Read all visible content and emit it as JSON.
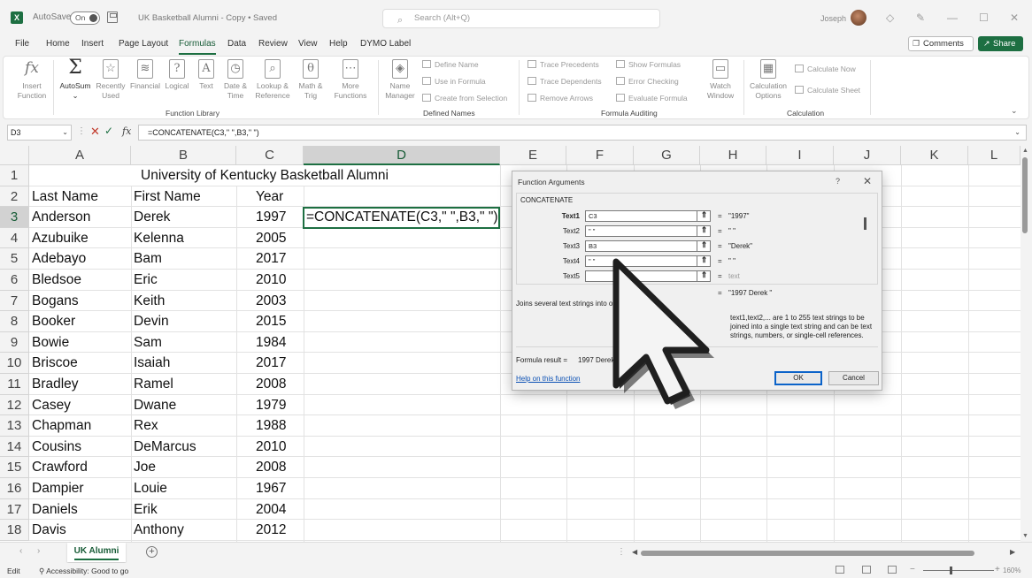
{
  "titlebar": {
    "autosave_label": "AutoSave",
    "autosave_state": "On",
    "doc_title": "UK Basketball Alumni - Copy • Saved",
    "search_placeholder": "Search (Alt+Q)",
    "user_name": "Joseph"
  },
  "menu": {
    "items": [
      "File",
      "Home",
      "Insert",
      "Page Layout",
      "Formulas",
      "Data",
      "Review",
      "View",
      "Help",
      "DYMO Label"
    ],
    "active": "Formulas",
    "comments_label": "Comments",
    "share_label": "Share"
  },
  "ribbon": {
    "insert_function": "Insert\nFunction",
    "autosum": "AutoSum",
    "recently_used": "Recently\nUsed",
    "financial": "Financial",
    "logical": "Logical",
    "text": "Text",
    "date_time": "Date &\nTime",
    "lookup_reference": "Lookup &\nReference",
    "math_trig": "Math &\nTrig",
    "more_functions": "More\nFunctions",
    "function_library": "Function Library",
    "name_manager": "Name\nManager",
    "define_name": "Define Name",
    "use_in_formula": "Use in Formula",
    "create_from_selection": "Create from Selection",
    "defined_names": "Defined Names",
    "trace_precedents": "Trace Precedents",
    "trace_dependents": "Trace Dependents",
    "remove_arrows": "Remove Arrows",
    "show_formulas": "Show Formulas",
    "error_checking": "Error Checking",
    "evaluate_formula": "Evaluate Formula",
    "watch_window": "Watch\nWindow",
    "formula_auditing": "Formula Auditing",
    "calculation_options": "Calculation\nOptions",
    "calculate_now": "Calculate Now",
    "calculate_sheet": "Calculate Sheet",
    "calculation": "Calculation"
  },
  "formula_bar": {
    "name_box": "D3",
    "formula": "=CONCATENATE(C3,\" \",B3,\" \")"
  },
  "sheet": {
    "columns": [
      "A",
      "B",
      "C",
      "D",
      "E",
      "F",
      "G",
      "H",
      "I",
      "J",
      "K",
      "L"
    ],
    "title": "University of Kentucky Basketball Alumni",
    "headers": {
      "last": "Last Name",
      "first": "First Name",
      "year": "Year"
    },
    "rows": [
      {
        "num": "1"
      },
      {
        "num": "2"
      },
      {
        "num": "3",
        "last": "Anderson",
        "first": "Derek",
        "year": "1997"
      },
      {
        "num": "4",
        "last": "Azubuike",
        "first": "Kelenna",
        "year": "2005"
      },
      {
        "num": "5",
        "last": "Adebayo",
        "first": "Bam",
        "year": "2017"
      },
      {
        "num": "6",
        "last": "Bledsoe",
        "first": "Eric",
        "year": "2010"
      },
      {
        "num": "7",
        "last": "Bogans",
        "first": "Keith",
        "year": "2003"
      },
      {
        "num": "8",
        "last": "Booker",
        "first": "Devin",
        "year": "2015"
      },
      {
        "num": "9",
        "last": "Bowie",
        "first": "Sam",
        "year": "1984"
      },
      {
        "num": "10",
        "last": "Briscoe",
        "first": "Isaiah",
        "year": "2017"
      },
      {
        "num": "11",
        "last": "Bradley",
        "first": "Ramel",
        "year": "2008"
      },
      {
        "num": "12",
        "last": "Casey",
        "first": "Dwane",
        "year": "1979"
      },
      {
        "num": "13",
        "last": "Chapman",
        "first": "Rex",
        "year": "1988"
      },
      {
        "num": "14",
        "last": "Cousins",
        "first": "DeMarcus",
        "year": "2010"
      },
      {
        "num": "15",
        "last": "Crawford",
        "first": "Joe",
        "year": "2008"
      },
      {
        "num": "16",
        "last": "Dampier",
        "first": "Louie",
        "year": "1967"
      },
      {
        "num": "17",
        "last": "Daniels",
        "first": "Erik",
        "year": "2004"
      },
      {
        "num": "18",
        "last": "Davis",
        "first": "Anthony",
        "year": "2012"
      }
    ],
    "d3_text": "=CONCATENATE(C3,\" \",B3,\" \")",
    "tab_name": "UK Alumni"
  },
  "dialog": {
    "title": "Function Arguments",
    "help_glyph": "?",
    "close_glyph": "✕",
    "function_name": "CONCATENATE",
    "args": [
      {
        "label": "Text1",
        "value": "C3",
        "result": "\"1997\""
      },
      {
        "label": "Text2",
        "value": "\" \"",
        "result": "\" \""
      },
      {
        "label": "Text3",
        "value": "B3",
        "result": "\"Derek\""
      },
      {
        "label": "Text4",
        "value": "\" \"",
        "result": "\" \""
      },
      {
        "label": "Text5",
        "value": "",
        "result": "text"
      }
    ],
    "eq": "=",
    "overall_result": "\"1997 Derek \"",
    "description": "Joins several text strings into one text string.",
    "detail": "text1,text2,... are 1 to 255 text strings to be joined into a single text string and can be text strings, numbers, or single-cell references.",
    "formula_result_label": "Formula result =",
    "formula_result_value": "1997 Derek",
    "help_link": "Help on this function",
    "ok_label": "OK",
    "cancel_label": "Cancel"
  },
  "status": {
    "mode": "Edit",
    "accessibility": "Accessibility: Good to go",
    "zoom": "160%"
  },
  "colors": {
    "accent": "#1d6f42",
    "link": "#0b50b4"
  }
}
